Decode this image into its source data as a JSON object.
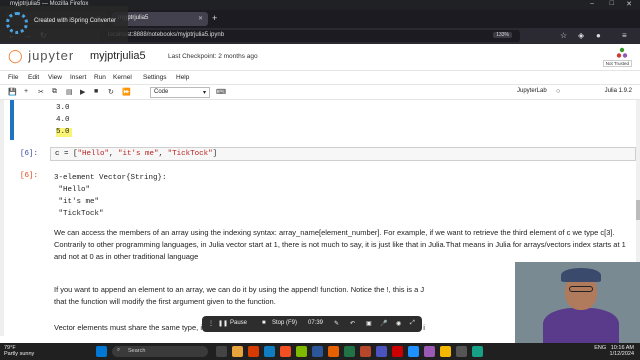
{
  "window": {
    "title": "myjptrjulia5 — Mozilla Firefox"
  },
  "recorder": {
    "text": "Created with iSpring Converter"
  },
  "tabs": [
    {
      "label": ""
    },
    {
      "label": "myjptrjulia5"
    }
  ],
  "url": {
    "value": "localhost:8888/notebooks/myjptrjulia5.ipynb",
    "zoom": "133%"
  },
  "jupyter": {
    "logo": "jupyter",
    "notebook_name": "myjptrjulia5",
    "checkpoint": "Last Checkpoint: 2 months ago",
    "trust": "Not Trusted"
  },
  "menu": [
    "File",
    "Edit",
    "View",
    "Insert",
    "Run",
    "Kernel",
    "Settings",
    "Help"
  ],
  "toolbar": {
    "cell_type": "Code",
    "jupyterlab": "JupyterLab",
    "kernel": "Julia 1.9.2"
  },
  "cells": {
    "prev_output": [
      "3.0",
      "4.0",
      "5.0"
    ],
    "in6_prompt": "[6]:",
    "in6_code_var": "c = [",
    "in6_s1": "\"Hello\"",
    "in6_s2": "\"it's me\"",
    "in6_s3": "\"TickTock\"",
    "in6_sep": ", ",
    "in6_end": "]",
    "out6_prompt": "[6]:",
    "out6_text": "3-element Vector{String}:\n \"Hello\"\n \"it's me\"\n \"TickTock\""
  },
  "paragraphs": [
    "We can access the members of an array using the indexing syntax: array_name[element_number]. For example, if we want to retrieve the third element of c we type c[3]. Contrarily to other programming languages, in Julia vector start at 1, there is not much to say, it is just like that in Julia.That means in Julia for arrays/vectors index starts at 1 and not at 0 as in other traditional language",
    "If you want to append an element to an array, we can do it by using the append! function. Notice the !, this is a J",
    "that the function will modify the first argument given to the function.",
    "Vector elements must share the same type, if we try to append (or add) a value to an array with a different type i"
  ],
  "recording": {
    "pause": "Pause",
    "stop": "Stop (F9)",
    "time": "07:39"
  },
  "taskbar": {
    "temp": "79°F",
    "weather": "Partly sunny",
    "search": "Search",
    "lang": "ENG",
    "time": "10:16 AM",
    "date": "1/12/2024"
  },
  "colors": {
    "accent": "#1e74c0",
    "jupyter_orange": "#f37726",
    "string_red": "#ba2121"
  }
}
